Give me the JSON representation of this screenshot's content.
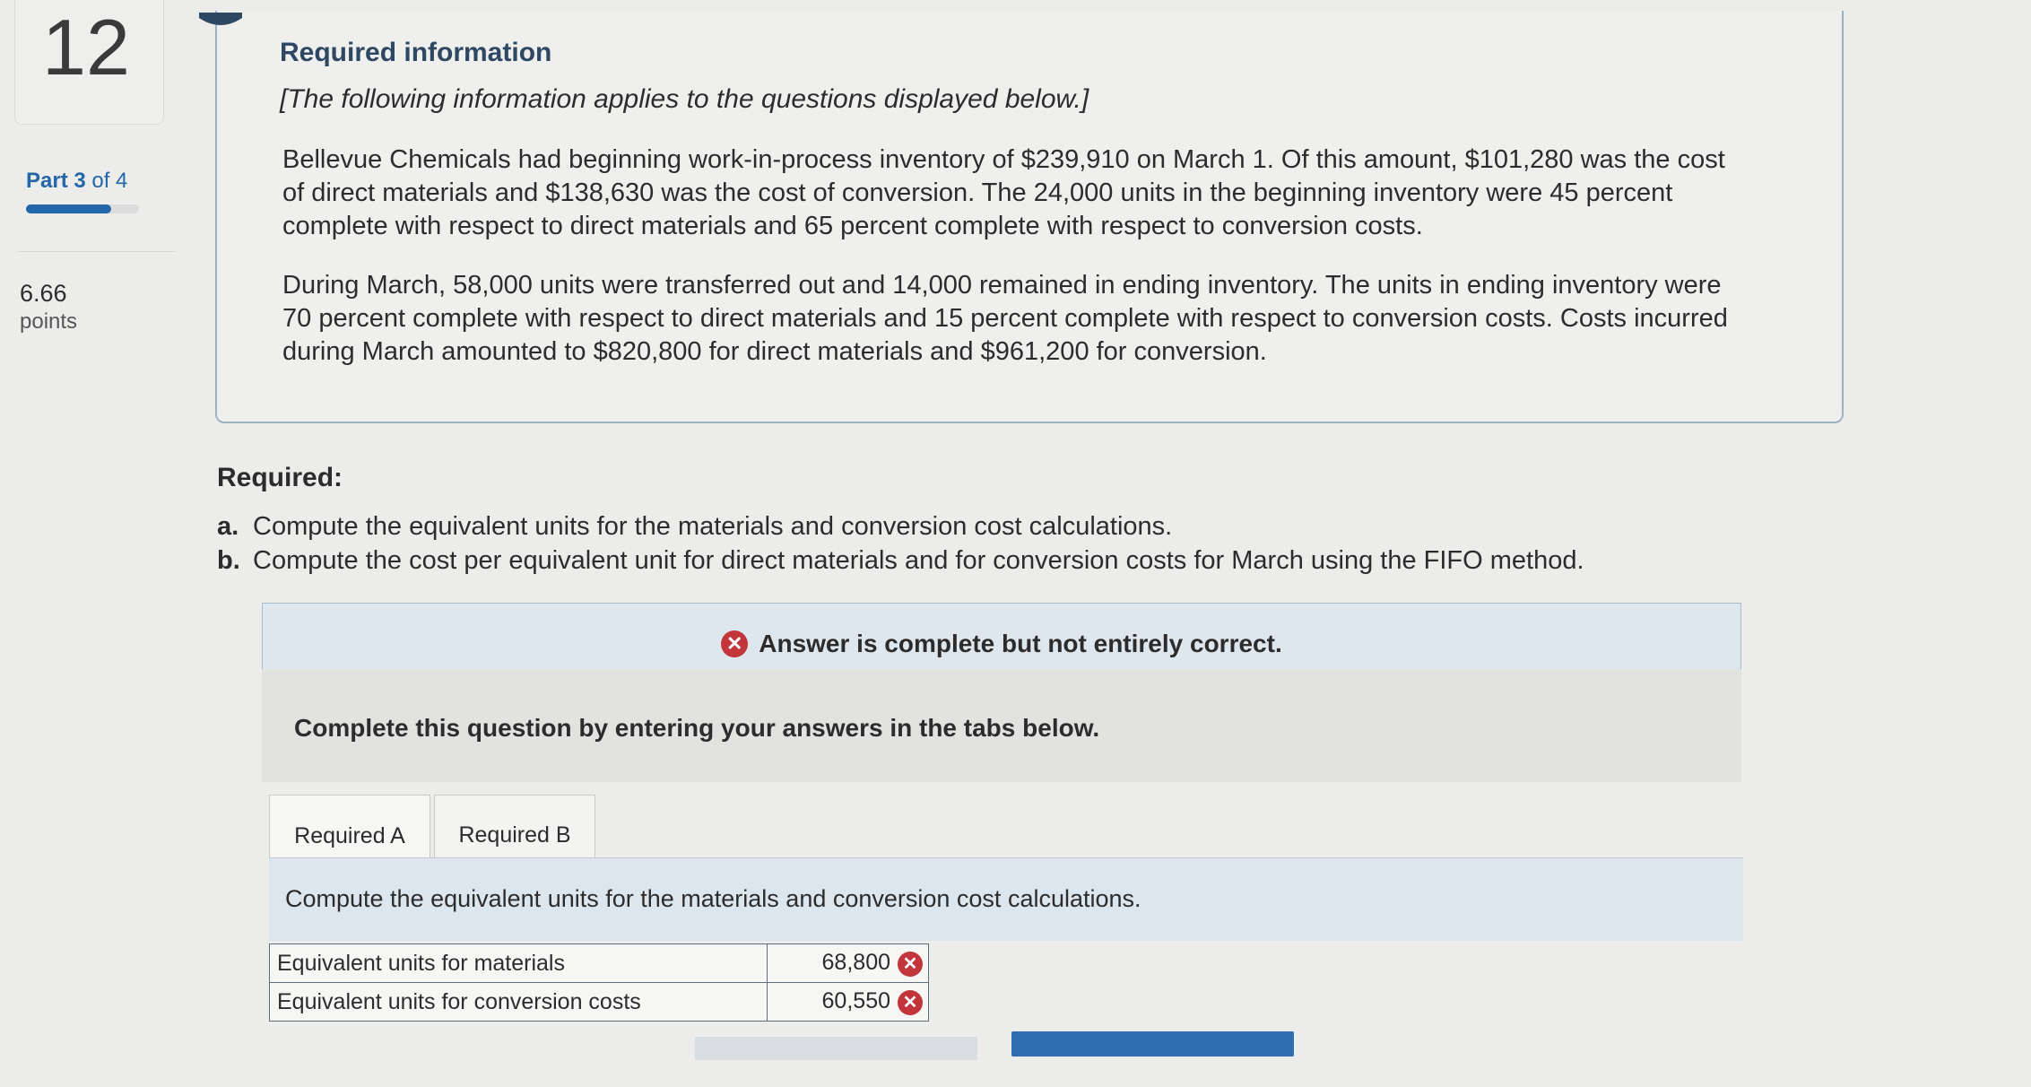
{
  "rail": {
    "question_number": "12",
    "part_prefix": "Part 3",
    "part_suffix": "of 4",
    "part_progress": 0.75,
    "points_value": "6.66",
    "points_label": "points"
  },
  "info": {
    "heading": "Required information",
    "intro": "[The following information applies to the questions displayed below.]",
    "para1": "Bellevue Chemicals had beginning work-in-process inventory of $239,910 on March 1. Of this amount, $101,280 was the cost of direct materials and $138,630 was the cost of conversion. The 24,000 units in the beginning inventory were 45 percent complete with respect to direct materials and 65 percent complete with respect to conversion costs.",
    "para2": "During March, 58,000 units were transferred out and 14,000 remained in ending inventory. The units in ending inventory were 70 percent complete with respect to direct materials and 15 percent complete with respect to conversion costs. Costs incurred during March amounted to $820,800 for direct materials and $961,200 for conversion."
  },
  "required": {
    "heading": "Required:",
    "items": [
      {
        "marker": "a.",
        "text": "Compute the equivalent units for the materials and conversion cost calculations."
      },
      {
        "marker": "b.",
        "text": "Compute the cost per equivalent unit for direct materials and for conversion costs for March using the FIFO method."
      }
    ]
  },
  "banner": {
    "icon": "x-circle-icon",
    "text": "Answer is complete but not entirely correct.",
    "icon_color": "#c2353a"
  },
  "instructions": "Complete this question by entering your answers in the tabs below.",
  "tabs": [
    {
      "label": "Required A",
      "active": true
    },
    {
      "label": "Required B",
      "active": false
    }
  ],
  "tab_content": {
    "prompt": "Compute the equivalent units for the materials and conversion cost calculations.",
    "rows": [
      {
        "label": "Equivalent units for materials",
        "value": "68,800",
        "status": "incorrect"
      },
      {
        "label": "Equivalent units for conversion costs",
        "value": "60,550",
        "status": "incorrect"
      }
    ]
  },
  "colors": {
    "accent": "#2467a8",
    "heading": "#2e4763",
    "error": "#c2353a"
  }
}
